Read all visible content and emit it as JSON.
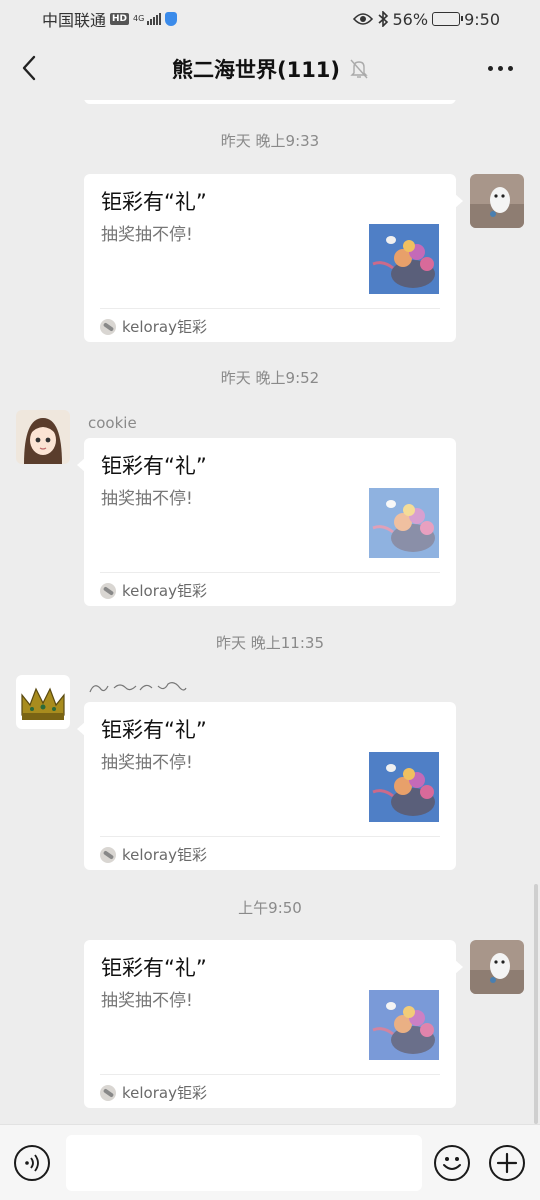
{
  "status_bar": {
    "carrier": "中国联通",
    "hd": "HD",
    "network": "4G",
    "battery_percent": "56%",
    "battery_level": 0.56,
    "time": "9:50"
  },
  "nav": {
    "title": "熊二海世界(111)"
  },
  "messages": [
    {
      "timestamp": "昨天 晚上9:33",
      "side": "right",
      "card": {
        "title": "钜彩有“礼”",
        "desc": "抽奖抽不停!",
        "source": "keloray钜彩"
      }
    },
    {
      "timestamp": "昨天 晚上9:52",
      "side": "left",
      "sender": "cookie",
      "card": {
        "title": "钜彩有“礼”",
        "desc": "抽奖抽不停!",
        "source": "keloray钜彩"
      }
    },
    {
      "timestamp": "昨天 晚上11:35",
      "side": "left",
      "card": {
        "title": "钜彩有“礼”",
        "desc": "抽奖抽不停!",
        "source": "keloray钜彩"
      }
    },
    {
      "timestamp": "上午9:50",
      "side": "right",
      "card": {
        "title": "钜彩有“礼”",
        "desc": "抽奖抽不停!",
        "source": "keloray钜彩"
      }
    }
  ],
  "input": {
    "placeholder": ""
  },
  "icons": {
    "back": "chevron-left-icon",
    "mute": "bell-off-icon",
    "more": "more-horizontal-icon",
    "voice": "voice-icon",
    "emoji": "emoji-icon",
    "plus": "plus-icon"
  },
  "colors": {
    "background": "#ededed",
    "card": "#ffffff",
    "timestamp": "#8a8a8a",
    "input_bar": "#f6f6f6"
  }
}
